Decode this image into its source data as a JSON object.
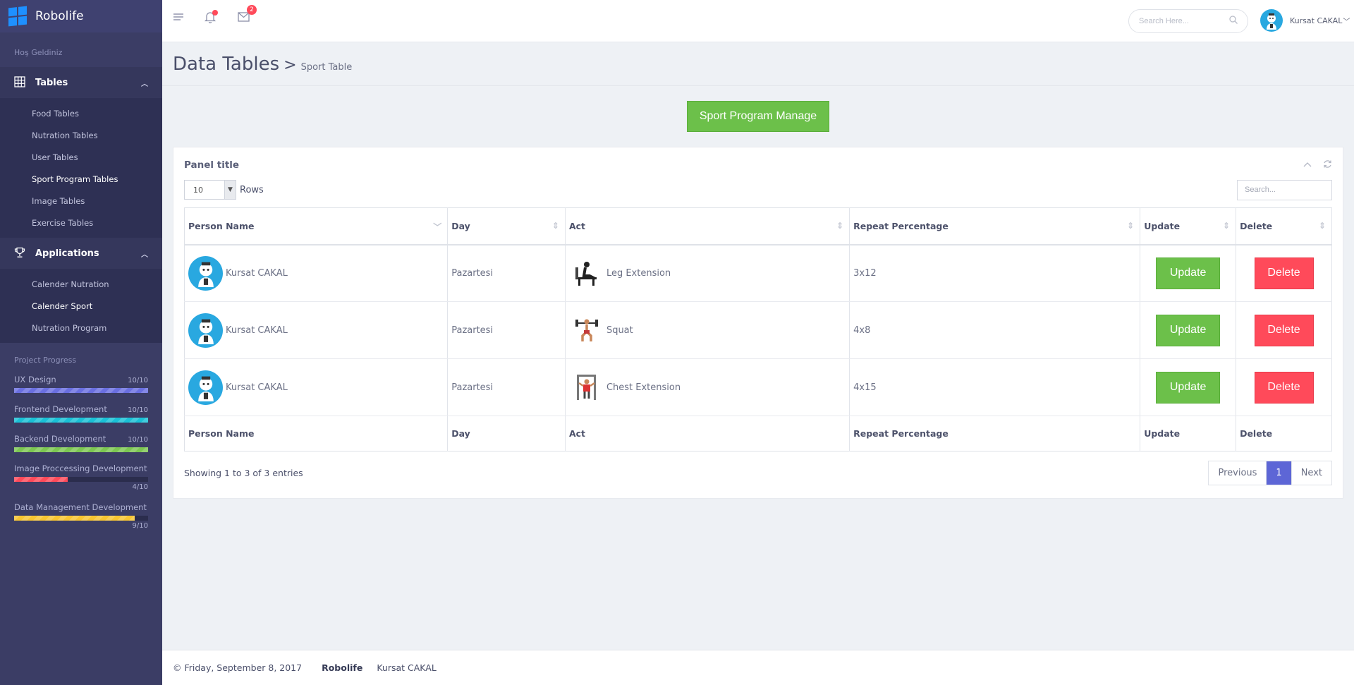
{
  "brand": {
    "name": "Robolife"
  },
  "sidebar": {
    "welcome": "Hoş Geldiniz",
    "tables": {
      "label": "Tables",
      "items": [
        {
          "label": "Food Tables"
        },
        {
          "label": "Nutration Tables"
        },
        {
          "label": "User Tables"
        },
        {
          "label": "Sport Program Tables"
        },
        {
          "label": "Image Tables"
        },
        {
          "label": "Exercise Tables"
        }
      ]
    },
    "applications": {
      "label": "Applications",
      "items": [
        {
          "label": "Calender Nutration"
        },
        {
          "label": "Calender Sport"
        },
        {
          "label": "Nutration Program"
        }
      ]
    },
    "progress_title": "Project Progress",
    "progress": [
      {
        "label": "UX Design",
        "value": "10/10",
        "fraction": 1.0,
        "color": "#6a6fe0"
      },
      {
        "label": "Frontend Development",
        "value": "10/10",
        "fraction": 1.0,
        "color": "#19c1d6"
      },
      {
        "label": "Backend Development",
        "value": "10/10",
        "fraction": 1.0,
        "color": "#7cc752"
      },
      {
        "label": "Image Proccessing Development",
        "value": "4/10",
        "fraction": 0.4,
        "color": "#ff4a5a"
      },
      {
        "label": "Data Management Development",
        "value": "9/10",
        "fraction": 0.9,
        "color": "#f7c531"
      }
    ]
  },
  "topbar": {
    "notifications_badge": "2",
    "search_placeholder": "Search Here...",
    "user_name": "Kursat CAKAL"
  },
  "page": {
    "title": "Data Tables",
    "separator": ">",
    "breadcrumb": "Sport Table",
    "manage_button": "Sport Program Manage"
  },
  "panel": {
    "title": "Panel title",
    "rows_value": "10",
    "rows_label": "Rows",
    "search_placeholder": "Search...",
    "columns": [
      "Person Name",
      "Day",
      "Act",
      "Repeat Percentage",
      "Update",
      "Delete"
    ],
    "rows": [
      {
        "person": "Kursat CAKAL",
        "day": "Pazartesi",
        "act": "Leg Extension",
        "repeat": "3x12",
        "update": "Update",
        "delete": "Delete"
      },
      {
        "person": "Kursat CAKAL",
        "day": "Pazartesi",
        "act": "Squat",
        "repeat": "4x8",
        "update": "Update",
        "delete": "Delete"
      },
      {
        "person": "Kursat CAKAL",
        "day": "Pazartesi",
        "act": "Chest Extension",
        "repeat": "4x15",
        "update": "Update",
        "delete": "Delete"
      }
    ],
    "info": "Showing 1 to 3 of 3 entries",
    "pager": {
      "previous": "Previous",
      "current": "1",
      "next": "Next"
    }
  },
  "footer": {
    "date": "© Friday, September 8, 2017",
    "brand": "Robolife",
    "author": "Kursat CAKAL"
  },
  "colors": {
    "sidebar": "#3b3d65",
    "green": "#6cc04a",
    "red": "#ff4a5a",
    "pager_active": "#5d66d6"
  }
}
